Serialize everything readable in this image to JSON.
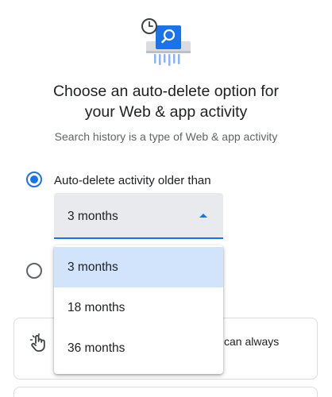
{
  "header": {
    "illustration_icon": "shredder-clock-search-icon",
    "title_line1": "Choose an auto-delete option for",
    "title_line2": "your Web & app activity",
    "subtitle": "Search history is a type of Web & app activity"
  },
  "options": {
    "auto_delete_label": "Auto-delete activity older than",
    "auto_delete_checked": true,
    "second_option_checked": false
  },
  "select": {
    "value": "3 months",
    "options": [
      "3 months",
      "18 months",
      "36 months"
    ],
    "selected_index": 0
  },
  "info_card": {
    "icon": "hand-pointer-icon",
    "text_visible": "can always"
  },
  "colors": {
    "accent": "#1a73e8",
    "selected_bg": "#d2e3fc",
    "field_bg": "#e8eaed"
  }
}
